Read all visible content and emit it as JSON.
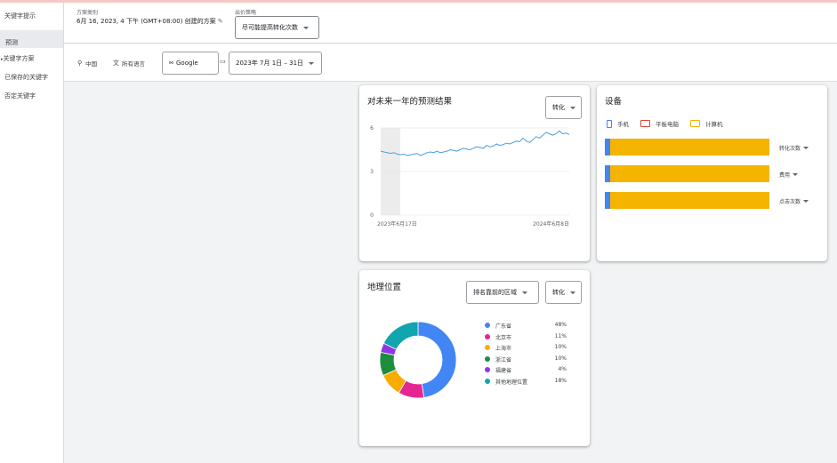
{
  "sidebar": {
    "items": [
      "关键字提示",
      "预测",
      "关键字方案",
      "已保存的关键字",
      "否定关键字"
    ]
  },
  "header": {
    "plan_label": "方案类别",
    "plan_text": "6月 16, 2023, 4 下午 (GMT+08:00) 创建的方案",
    "bid_label": "出价策略",
    "bid_value": "尽可能提高转化次数"
  },
  "filters": {
    "location": "中国",
    "language": "所有语言",
    "network": "Google",
    "date_range": "2023年 7月 1日 – 31日"
  },
  "forecast": {
    "title": "对未来一年的预测结果",
    "metric_button": "转化"
  },
  "chart_data": {
    "type": "line",
    "y_ticks": [
      "6",
      "3",
      "0"
    ],
    "ylim": [
      0,
      6
    ],
    "x_labels": [
      "2023年6月17日",
      "2024年6月8日"
    ],
    "values": [
      4.4,
      4.35,
      4.3,
      4.25,
      4.3,
      4.2,
      4.15,
      4.2,
      4.1,
      4.15,
      4.2,
      4.25,
      4.1,
      4.2,
      4.3,
      4.35,
      4.3,
      4.4,
      4.3,
      4.35,
      4.4,
      4.5,
      4.45,
      4.4,
      4.5,
      4.6,
      4.55,
      4.5,
      4.6,
      4.7,
      4.65,
      4.6,
      4.8,
      4.7,
      4.75,
      4.9,
      4.8,
      4.85,
      4.95,
      4.9,
      5.0,
      5.1,
      5.05,
      5.3,
      5.1,
      5.0,
      5.2,
      5.4,
      5.3,
      5.5,
      5.7,
      5.6,
      5.5,
      5.6,
      5.8,
      5.6,
      5.65,
      5.55
    ]
  },
  "devices": {
    "title": "设备",
    "legend": [
      {
        "name": "手机",
        "color": "#4285f4"
      },
      {
        "name": "平板电脑",
        "color": "#db4437"
      },
      {
        "name": "计算机",
        "color": "#f4b400"
      }
    ],
    "rows": [
      {
        "label": "转化次数"
      },
      {
        "label": "费用"
      },
      {
        "label": "点击次数"
      }
    ]
  },
  "geo": {
    "title": "地理位置",
    "region_button": "排名靠前的区域",
    "metric_button": "转化",
    "items": [
      {
        "name": "广东省",
        "pct": "48%",
        "value": 48,
        "color": "#4285f4"
      },
      {
        "name": "北京市",
        "pct": "11%",
        "value": 11,
        "color": "#e52592"
      },
      {
        "name": "上海市",
        "pct": "10%",
        "value": 10,
        "color": "#f9ab00"
      },
      {
        "name": "浙江省",
        "pct": "10%",
        "value": 10,
        "color": "#1e8e3e"
      },
      {
        "name": "福建省",
        "pct": "4%",
        "value": 4,
        "color": "#9334e6"
      },
      {
        "name": "其他地理位置",
        "pct": "18%",
        "value": 18,
        "color": "#12a4af"
      }
    ]
  }
}
